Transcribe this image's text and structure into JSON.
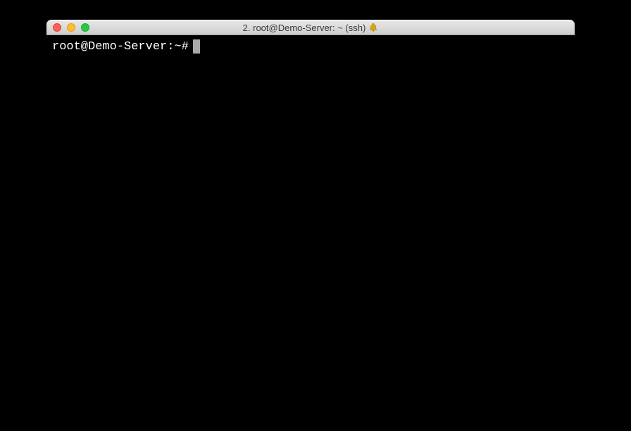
{
  "window": {
    "title": "2. root@Demo-Server: ~ (ssh)",
    "bell_icon_name": "bell-icon"
  },
  "terminal": {
    "prompt": "root@Demo-Server:~#"
  }
}
